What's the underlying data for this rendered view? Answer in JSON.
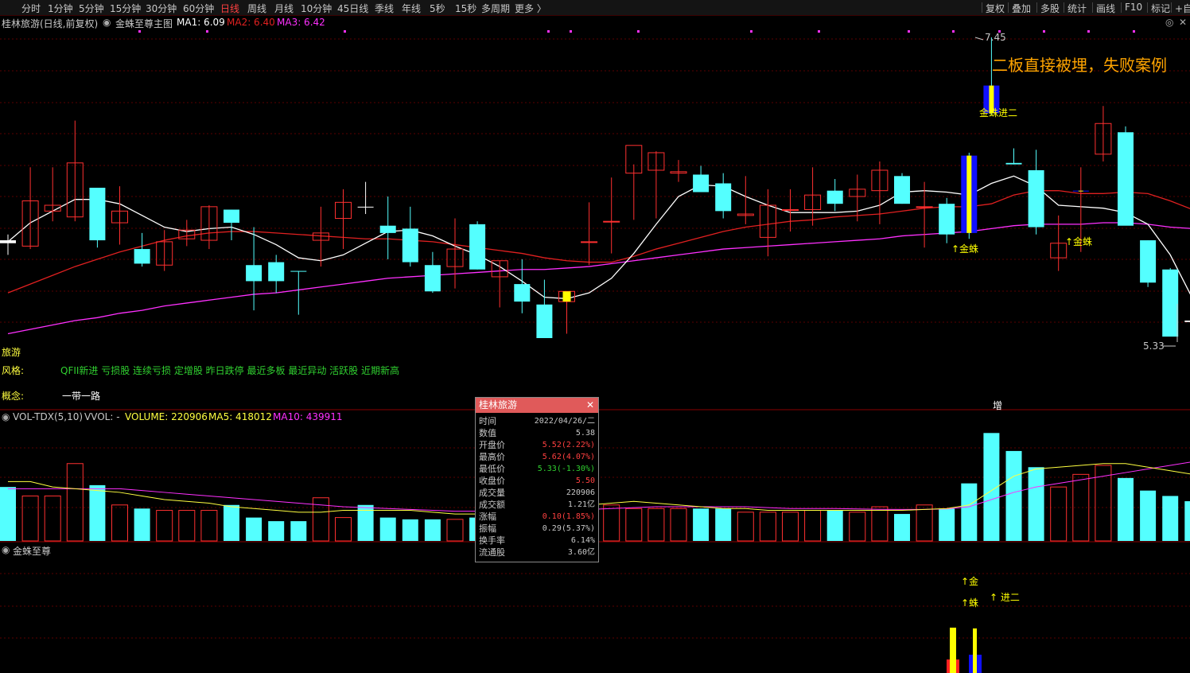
{
  "toolbar": {
    "periods": [
      "分时",
      "1分钟",
      "5分钟",
      "15分钟",
      "30分钟",
      "60分钟",
      "日线",
      "周线",
      "月线",
      "10分钟",
      "45日线",
      "季线",
      "年线",
      "5秒",
      "15秒",
      "多周期",
      "更多 〉"
    ],
    "active_period": "日线",
    "right_buttons": [
      "复权",
      "叠加",
      "多股",
      "统计",
      "画线",
      "F10",
      "标记",
      "+自"
    ]
  },
  "chart_header": {
    "stock_title": "桂林旅游(日线,前复权)",
    "indicator_name": "金蛛至尊主图",
    "ma1": "MA1: 6.09",
    "ma2": "MA2: 6.40",
    "ma3": "MA3: 6.42"
  },
  "annotations": {
    "headline": "二板直接被埋，失败案例",
    "high_price": "7.45",
    "low_price": "5.33",
    "jinzhu_jiner": "金蛛进二",
    "jinzhu_1": "↑金蛛",
    "jinzhu_2": "↑金蛛",
    "zeng": "增"
  },
  "info": {
    "industry": "旅游",
    "style_label": "风格:",
    "style_tags": "QFII新进 亏损股 连续亏损 定增股 昨日跌停 最近多板 最近异动 活跃股 近期新高",
    "concept_label": "概念:",
    "concept_tags": "一带一路"
  },
  "volume_header": {
    "name": "VOL-TDX(5,10)",
    "vvol": "VVOL: -",
    "volume": "VOLUME: 220906",
    "ma5": "MA5: 418012",
    "ma10": "MA10: 439911"
  },
  "indicator_panel": {
    "name": "金蛛至尊",
    "jin": "↑金",
    "zhu": "↑蛛",
    "jiner": "↑ 进二"
  },
  "tooltip": {
    "title": "桂林旅游",
    "rows": [
      {
        "k": "时间",
        "v": "2022/04/26/二",
        "c": "#c8c8c8"
      },
      {
        "k": "数值",
        "v": "5.38",
        "c": "#c8c8c8"
      },
      {
        "k": "开盘价",
        "v": "5.52(2.22%)",
        "c": "#ff4040"
      },
      {
        "k": "最高价",
        "v": "5.62(4.07%)",
        "c": "#ff4040"
      },
      {
        "k": "最低价",
        "v": "5.33(-1.30%)",
        "c": "#30d030"
      },
      {
        "k": "收盘价",
        "v": "5.50",
        "c": "#ff4040"
      },
      {
        "k": "成交量",
        "v": "220906",
        "c": "#c8c8c8"
      },
      {
        "k": "成交额",
        "v": "1.21亿",
        "c": "#c8c8c8"
      },
      {
        "k": "涨幅",
        "v": "0.10(1.85%)",
        "c": "#ff4040"
      },
      {
        "k": "振幅",
        "v": "0.29(5.37%)",
        "c": "#c8c8c8"
      },
      {
        "k": "换手率",
        "v": "6.14%",
        "c": "#c8c8c8"
      },
      {
        "k": "流通股",
        "v": "3.60亿",
        "c": "#c8c8c8"
      }
    ]
  },
  "colors": {
    "up": "#ff3030",
    "down": "#54ffff",
    "ma1": "#ffffff",
    "ma2": "#e02020",
    "ma3": "#ff30ff",
    "signal_yellow": "#ffff00",
    "signal_blue": "#1010ff",
    "accent_orange": "#ffa500"
  },
  "chart_data": {
    "type": "candlestick",
    "price_range": [
      5.33,
      7.45
    ],
    "candles": [
      {
        "o": 6.06,
        "h": 6.1,
        "l": 5.96,
        "c": 6.04,
        "s": "flat"
      },
      {
        "o": 6.02,
        "h": 6.56,
        "l": 6.0,
        "c": 6.33,
        "s": "up"
      },
      {
        "o": 6.3,
        "h": 6.56,
        "l": 6.19,
        "c": 6.26,
        "s": "up"
      },
      {
        "o": 6.22,
        "h": 6.88,
        "l": 6.19,
        "c": 6.59,
        "s": "up"
      },
      {
        "o": 6.42,
        "h": 6.42,
        "l": 6.01,
        "c": 6.06,
        "s": "down"
      },
      {
        "o": 6.18,
        "h": 6.43,
        "l": 6.03,
        "c": 6.26,
        "s": "up"
      },
      {
        "o": 6.0,
        "h": 6.11,
        "l": 5.88,
        "c": 5.9,
        "s": "down"
      },
      {
        "o": 6.05,
        "h": 6.13,
        "l": 5.85,
        "c": 5.89,
        "s": "up"
      },
      {
        "o": 6.13,
        "h": 6.2,
        "l": 6.02,
        "c": 6.07,
        "s": "up"
      },
      {
        "o": 6.29,
        "h": 6.3,
        "l": 6.0,
        "c": 6.06,
        "s": "up"
      },
      {
        "o": 6.27,
        "h": 6.27,
        "l": 6.06,
        "c": 6.18,
        "s": "down"
      },
      {
        "o": 5.89,
        "h": 6.15,
        "l": 5.58,
        "c": 5.78,
        "s": "down"
      },
      {
        "o": 5.78,
        "h": 5.96,
        "l": 5.7,
        "c": 5.91,
        "s": "down"
      },
      {
        "o": 5.85,
        "h": 5.85,
        "l": 5.55,
        "c": 5.85,
        "s": "down"
      },
      {
        "o": 6.11,
        "h": 6.29,
        "l": 5.88,
        "c": 6.06,
        "s": "up"
      },
      {
        "o": 6.32,
        "h": 6.41,
        "l": 6.0,
        "c": 6.21,
        "s": "up"
      },
      {
        "o": 6.29,
        "h": 6.46,
        "l": 6.24,
        "c": 6.29,
        "s": "flat"
      },
      {
        "o": 6.16,
        "h": 6.36,
        "l": 5.93,
        "c": 6.11,
        "s": "down"
      },
      {
        "o": 6.14,
        "h": 6.29,
        "l": 5.88,
        "c": 5.91,
        "s": "down"
      },
      {
        "o": 5.89,
        "h": 5.98,
        "l": 5.7,
        "c": 5.71,
        "s": "down"
      },
      {
        "o": 5.88,
        "h": 6.21,
        "l": 5.73,
        "c": 6.0,
        "s": "up"
      },
      {
        "o": 6.17,
        "h": 6.19,
        "l": 5.86,
        "c": 5.86,
        "s": "down"
      },
      {
        "o": 5.92,
        "h": 5.92,
        "l": 5.6,
        "c": 5.81,
        "s": "up"
      },
      {
        "o": 5.76,
        "h": 5.93,
        "l": 5.56,
        "c": 5.64,
        "s": "down"
      },
      {
        "o": 5.62,
        "h": 5.79,
        "l": 5.4,
        "c": 5.39,
        "s": "down"
      },
      {
        "o": 5.64,
        "h": 5.64,
        "l": 5.42,
        "c": 5.71,
        "s": "up"
      },
      {
        "o": 6.05,
        "h": 6.32,
        "l": 5.89,
        "c": 6.05,
        "s": "up"
      },
      {
        "o": 6.19,
        "h": 6.49,
        "l": 5.97,
        "c": 6.19,
        "s": "up"
      },
      {
        "o": 6.52,
        "h": 6.58,
        "l": 6.2,
        "c": 6.71,
        "s": "up"
      },
      {
        "o": 6.66,
        "h": 6.67,
        "l": 6.21,
        "c": 6.54,
        "s": "up"
      },
      {
        "o": 6.52,
        "h": 6.61,
        "l": 6.46,
        "c": 6.53,
        "s": "up"
      },
      {
        "o": 6.51,
        "h": 6.57,
        "l": 6.41,
        "c": 6.39,
        "s": "down"
      },
      {
        "o": 6.45,
        "h": 6.52,
        "l": 6.21,
        "c": 6.26,
        "s": "down"
      },
      {
        "o": 6.24,
        "h": 6.5,
        "l": 6.17,
        "c": 6.23,
        "s": "up"
      },
      {
        "o": 6.3,
        "h": 6.41,
        "l": 5.95,
        "c": 6.08,
        "s": "up"
      },
      {
        "o": 6.27,
        "h": 6.41,
        "l": 6.12,
        "c": 6.27,
        "s": "up"
      },
      {
        "o": 6.37,
        "h": 6.56,
        "l": 6.16,
        "c": 6.27,
        "s": "up"
      },
      {
        "o": 6.4,
        "h": 6.48,
        "l": 6.26,
        "c": 6.31,
        "s": "down"
      },
      {
        "o": 6.36,
        "h": 6.51,
        "l": 6.19,
        "c": 6.41,
        "s": "up"
      },
      {
        "o": 6.4,
        "h": 6.6,
        "l": 6.17,
        "c": 6.54,
        "s": "up"
      },
      {
        "o": 6.5,
        "h": 6.52,
        "l": 6.31,
        "c": 6.31,
        "s": "down"
      },
      {
        "o": 6.29,
        "h": 6.46,
        "l": 6.01,
        "c": 6.29,
        "s": "up"
      },
      {
        "o": 6.31,
        "h": 6.35,
        "l": 6.04,
        "c": 6.1,
        "s": "down"
      },
      {
        "o": 6.64,
        "h": 6.66,
        "l": 6.07,
        "c": 6.11,
        "s": "down"
      },
      {
        "o": 7.12,
        "h": 7.45,
        "l": 6.92,
        "c": 6.93,
        "s": "down"
      },
      {
        "o": 6.58,
        "h": 6.69,
        "l": 6.58,
        "c": 6.59,
        "s": "down"
      },
      {
        "o": 6.54,
        "h": 6.68,
        "l": 6.1,
        "c": 6.15,
        "s": "down"
      },
      {
        "o": 5.94,
        "h": 6.23,
        "l": 5.85,
        "c": 6.04,
        "s": "up"
      },
      {
        "o": 6.4,
        "h": 6.56,
        "l": 5.98,
        "c": 6.4,
        "s": "up"
      },
      {
        "o": 6.86,
        "h": 6.98,
        "l": 6.6,
        "c": 6.65,
        "s": "up"
      },
      {
        "o": 6.8,
        "h": 6.84,
        "l": 6.2,
        "c": 6.16,
        "s": "down"
      },
      {
        "o": 6.06,
        "h": 6.06,
        "l": 5.74,
        "c": 5.77,
        "s": "down"
      },
      {
        "o": 5.86,
        "h": 5.87,
        "l": 5.42,
        "c": 5.4,
        "s": "down"
      },
      {
        "o": 5.51,
        "h": 5.62,
        "l": 5.33,
        "c": 5.5,
        "s": "flat"
      }
    ],
    "volumes": [
      300000,
      250000,
      250000,
      430000,
      310000,
      200000,
      180000,
      170000,
      170000,
      170000,
      200000,
      130000,
      110000,
      110000,
      240000,
      130000,
      200000,
      130000,
      120000,
      120000,
      120000,
      130000,
      180000,
      160000,
      180000,
      260000,
      240000,
      200000,
      180000,
      180000,
      180000,
      180000,
      180000,
      160000,
      160000,
      160000,
      170000,
      170000,
      160000,
      190000,
      150000,
      200000,
      180000,
      320000,
      600000,
      500000,
      410000,
      300000,
      370000,
      420000,
      350000,
      280000,
      250000,
      220906
    ]
  }
}
